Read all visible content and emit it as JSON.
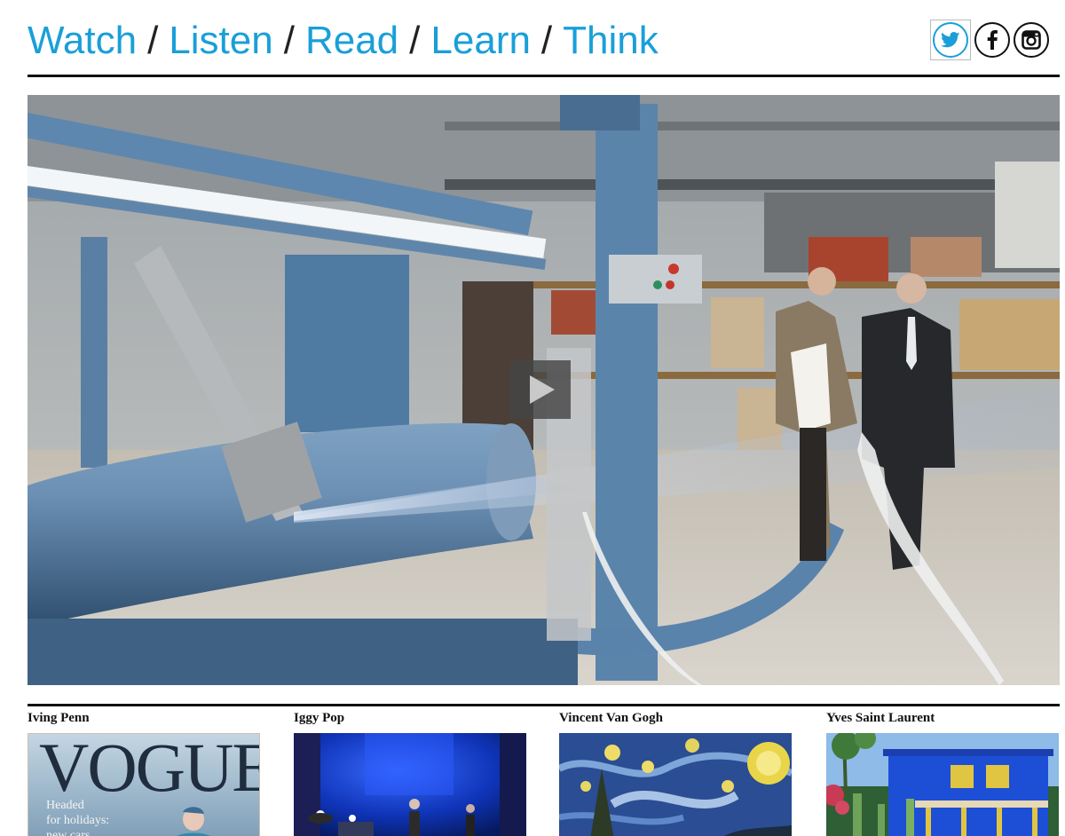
{
  "nav": {
    "items": [
      {
        "label": "Watch"
      },
      {
        "label": "Listen"
      },
      {
        "label": "Read"
      },
      {
        "label": "Learn"
      },
      {
        "label": "Think"
      }
    ],
    "separator": "/"
  },
  "social": {
    "twitter_icon": "twitter-icon",
    "facebook_icon": "facebook-icon",
    "instagram_icon": "instagram-icon",
    "accent": "#1a9fd8"
  },
  "featured_video": {
    "play_icon": "play-icon"
  },
  "cards": [
    {
      "title": "Iving Penn",
      "thumb": {
        "masthead": "VOGUE",
        "line1": "Headed",
        "line2": "for holidays:",
        "line3": "new cars"
      }
    },
    {
      "title": "Iggy Pop"
    },
    {
      "title": "Vincent Van Gogh"
    },
    {
      "title": "Yves Saint Laurent"
    }
  ]
}
